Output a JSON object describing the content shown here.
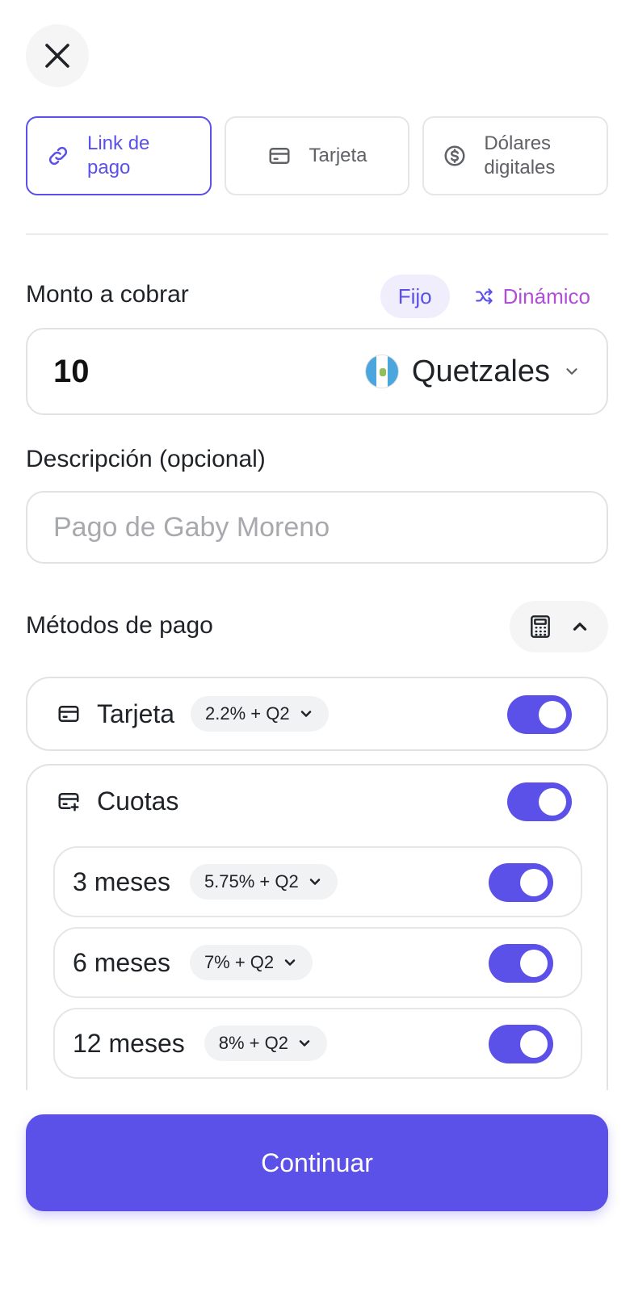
{
  "tabs": [
    {
      "label": "Link de pago",
      "icon": "link-icon",
      "active": true
    },
    {
      "label": "Tarjeta",
      "icon": "card-icon",
      "active": false
    },
    {
      "label": "Dólares digitales",
      "icon": "dollar-circle-icon",
      "active": false
    }
  ],
  "amount": {
    "label": "Monto a cobrar",
    "mode_fixed": "Fijo",
    "mode_dynamic": "Dinámico",
    "value": "10",
    "currency": "Quetzales"
  },
  "description": {
    "label": "Descripción (opcional)",
    "placeholder": "Pago de Gaby Moreno"
  },
  "methods": {
    "label": "Métodos de pago",
    "tarjeta": {
      "label": "Tarjeta",
      "fee": "2.2% + Q2",
      "enabled": true
    },
    "cuotas": {
      "label": "Cuotas",
      "enabled": true,
      "plans": [
        {
          "label": "3 meses",
          "fee": "5.75% + Q2",
          "enabled": true
        },
        {
          "label": "6 meses",
          "fee": "7% + Q2",
          "enabled": true
        },
        {
          "label": "12 meses",
          "fee": "8% + Q2",
          "enabled": true
        }
      ]
    }
  },
  "continue_label": "Continuar",
  "colors": {
    "accent": "#5b50e8",
    "dynamic": "#b34dd6"
  }
}
